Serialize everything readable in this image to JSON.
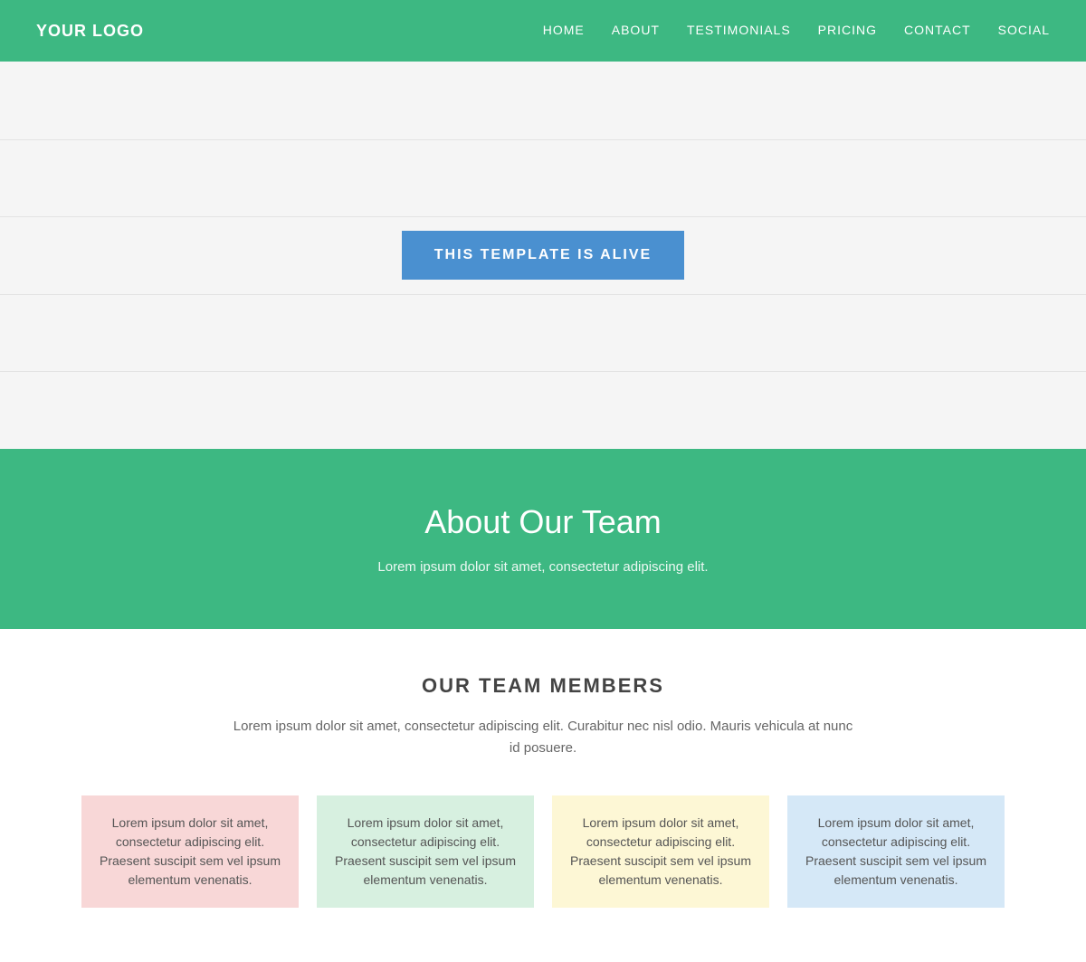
{
  "nav": {
    "logo": "YOUR LOGO",
    "links": [
      {
        "label": "HOME",
        "href": "#"
      },
      {
        "label": "ABOUT",
        "href": "#"
      },
      {
        "label": "TESTIMONIALS",
        "href": "#"
      },
      {
        "label": "PRICING",
        "href": "#"
      },
      {
        "label": "CONTACT",
        "href": "#"
      },
      {
        "label": "SOCIAL",
        "href": "#"
      }
    ]
  },
  "hero": {
    "button_label": "THIS TEMPLATE IS ALIVE"
  },
  "about": {
    "title": "About Our Team",
    "subtitle": "Lorem ipsum dolor sit amet, consectetur adipiscing elit."
  },
  "team": {
    "title": "OUR TEAM MEMBERS",
    "description": "Lorem ipsum dolor sit amet, consectetur adipiscing elit. Curabitur nec nisl odio. Mauris vehicula at nunc id posuere.",
    "cards": [
      {
        "text": "Lorem ipsum dolor sit amet, consectetur adipiscing elit. Praesent suscipit sem vel ipsum elementum venenatis.",
        "color_class": "team-card-1"
      },
      {
        "text": "Lorem ipsum dolor sit amet, consectetur adipiscing elit. Praesent suscipit sem vel ipsum elementum venenatis.",
        "color_class": "team-card-2"
      },
      {
        "text": "Lorem ipsum dolor sit amet, consectetur adipiscing elit. Praesent suscipit sem vel ipsum elementum venenatis.",
        "color_class": "team-card-3"
      },
      {
        "text": "Lorem ipsum dolor sit amet, consectetur adipiscing elit. Praesent suscipit sem vel ipsum elementum venenatis.",
        "color_class": "team-card-4"
      }
    ]
  }
}
